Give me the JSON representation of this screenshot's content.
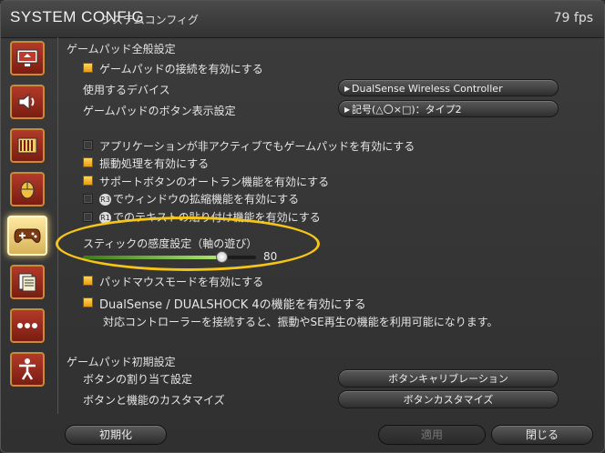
{
  "title": {
    "main": "SYSTEM CONFIG",
    "sub": "システムコンフィグ",
    "fps": "79 fps"
  },
  "sidebar": {
    "items": [
      {
        "icon": "monitor-icon"
      },
      {
        "icon": "speaker-icon"
      },
      {
        "icon": "film-icon"
      },
      {
        "icon": "mouse-icon"
      },
      {
        "icon": "gamepad-icon",
        "active": true
      },
      {
        "icon": "document-icon"
      },
      {
        "icon": "more-icon"
      },
      {
        "icon": "accessibility-icon"
      }
    ]
  },
  "gamepad_settings": {
    "section_title": "ゲームパッド全般設定",
    "enable_connection": "ゲームパッドの接続を有効にする",
    "device_label": "使用するデバイス",
    "device_value": "DualSense Wireless Controller",
    "button_display_label": "ゲームパッドのボタン表示設定",
    "button_display_value": "記号(△〇×□)：タイプ2",
    "inactive_enable": "アプリケーションが非アクティブでもゲームパッドを有効にする",
    "vibration": "振動処理を有効にする",
    "support_autorun": "サポートボタンのオートラン機能を有効にする",
    "window_expand": "でウィンドウの拡縮機能を有効にする",
    "window_expand_icon_text": "R3",
    "text_paste": "でのテキストの貼り付け機能を有効にする",
    "text_paste_icon_text": "R1",
    "stick_sensitivity_label": "スティックの感度設定（軸の遊び）",
    "stick_sensitivity_value": "80",
    "stick_sensitivity_level": 0.8,
    "pad_mouse_mode": "パッドマウスモードを有効にする",
    "dualsense_features": "DualSense / DUALSHOCK 4の機能を有効にする",
    "dualsense_note": "対応コントローラーを接続すると、振動やSE再生の機能を利用可能になります。"
  },
  "initial_settings": {
    "section_title": "ゲームパッド初期設定",
    "button_assign_label": "ボタンの割り当て設定",
    "button_assign_button": "ボタンキャリブレーション",
    "customize_label": "ボタンと機能のカスタマイズ",
    "customize_button": "ボタンカスタマイズ"
  },
  "footer": {
    "reset": "初期化",
    "apply": "適用",
    "close": "閉じる"
  },
  "colors": {
    "checkbox_on": "#f0b22a",
    "highlight": "#f5c518",
    "slider": "#8fd24f"
  }
}
